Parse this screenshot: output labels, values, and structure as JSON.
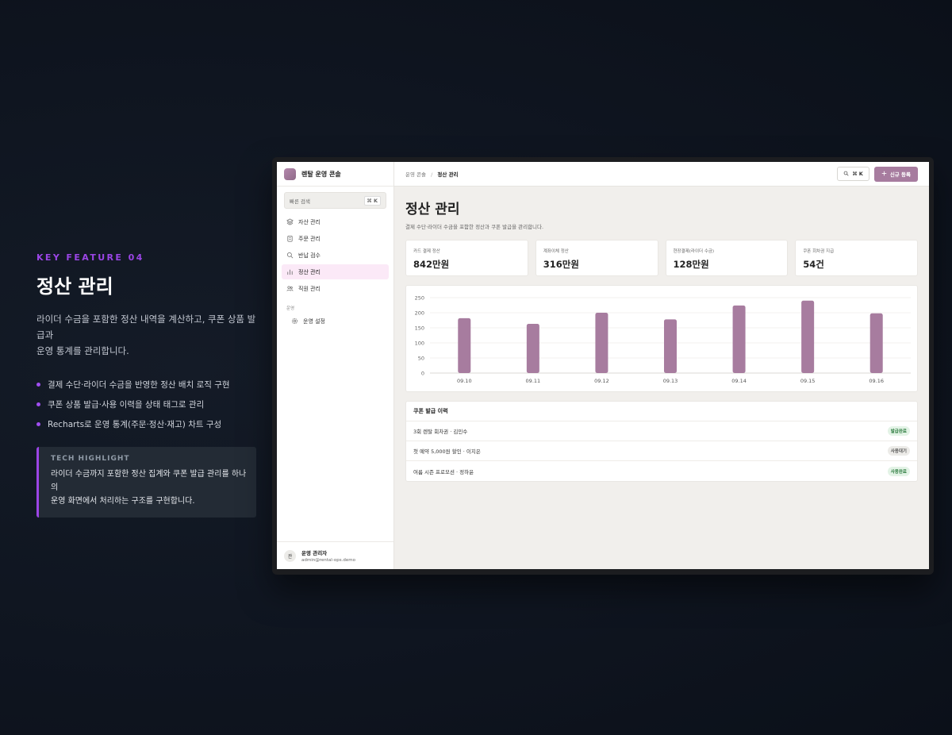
{
  "feature": {
    "kicker": "KEY FEATURE 04",
    "title": "정산 관리",
    "description_line1": "라이더 수금을 포함한 정산 내역을 계산하고, 쿠폰 상품 발급과",
    "description_line2": "운영 통계를 관리합니다.",
    "bullets": [
      "결제 수단·라이더 수금을 반영한 정산 배치 로직 구현",
      "쿠폰 상품 발급·사용 이력을 상태 태그로 관리",
      "Recharts로 운영 통계(주문·정산·재고) 차트 구성"
    ],
    "tech_label": "TECH HIGHLIGHT",
    "tech_line1": "라이더 수금까지 포함한 정산 집계와 쿠폰 발급 관리를 하나의",
    "tech_line2": "운영 화면에서 처리하는 구조를 구현합니다."
  },
  "app": {
    "brand": "렌탈 운영 콘솔",
    "quick_search": "빠른 검색",
    "quick_search_kbd": "⌘ K",
    "nav": [
      {
        "label": "자산 관리",
        "icon": "layers-icon"
      },
      {
        "label": "주문 관리",
        "icon": "clipboard-icon"
      },
      {
        "label": "반납 검수",
        "icon": "search-icon"
      },
      {
        "label": "정산 관리",
        "icon": "bar-chart-icon",
        "active": true
      },
      {
        "label": "직원 관리",
        "icon": "users-icon"
      }
    ],
    "section_label": "운영",
    "settings_label": "운영 설정",
    "user_avatar": "관",
    "user_name": "운영 관리자",
    "user_email": "admin@rental-ops.demo",
    "breadcrumb_parent": "운영 콘솔",
    "breadcrumb_sep": "/",
    "breadcrumb_current": "정산 관리",
    "search_kbd": "⌘ K",
    "new_button": "신규 등록",
    "page_title": "정산 관리",
    "page_desc": "결제 수단·라이더 수금을 포함한 정산과 쿠폰 발급을 관리합니다.",
    "kpis": [
      {
        "label": "카드 결제 정산",
        "value": "842만원"
      },
      {
        "label": "계좌이체 정산",
        "value": "316만원"
      },
      {
        "label": "현장결제(라이더 수금)",
        "value": "128만원"
      },
      {
        "label": "쿠폰 회차권 지급",
        "value": "54건"
      }
    ],
    "coupons_title": "쿠폰 발급 이력",
    "coupons": [
      {
        "name": "3회 렌탈 회차권 · 김민수",
        "status": "발급완료",
        "tone": "green"
      },
      {
        "name": "첫 예약 5,000원 할인 · 이지은",
        "status": "사용대기",
        "tone": "gray"
      },
      {
        "name": "여름 시즌 프로모션 · 정하윤",
        "status": "사용완료",
        "tone": "green"
      }
    ]
  },
  "colors": {
    "accent": "#9b45e6",
    "bar": "#a77c9f",
    "primary_button": "#a77c9f"
  },
  "chart_data": {
    "type": "bar",
    "categories": [
      "09.10",
      "09.11",
      "09.12",
      "09.13",
      "09.14",
      "09.15",
      "09.16"
    ],
    "values": [
      182,
      163,
      200,
      178,
      224,
      240,
      198
    ],
    "yticks": [
      0,
      50,
      100,
      150,
      200,
      250
    ],
    "ylim": [
      0,
      250
    ],
    "grid": true
  }
}
